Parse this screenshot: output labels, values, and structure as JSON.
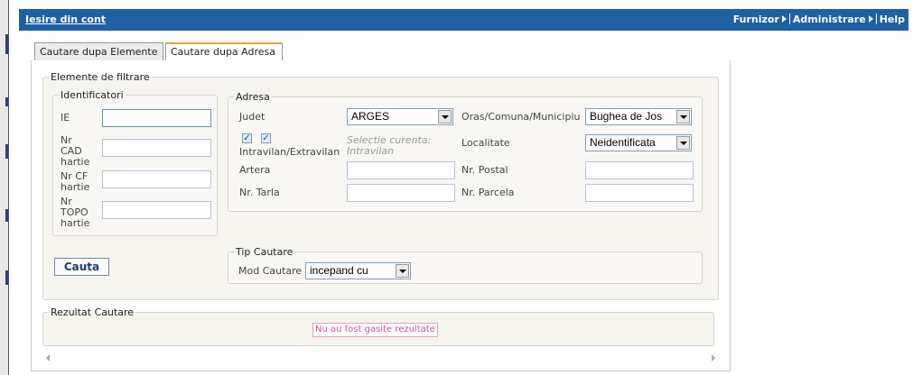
{
  "header": {
    "logout_label": "Iesire din cont",
    "nav": [
      "Furnizor",
      "Administrare",
      "Help"
    ]
  },
  "tabs": [
    {
      "label": "Cautare dupa Elemente",
      "active": false
    },
    {
      "label": "Cautare dupa Adresa",
      "active": true
    }
  ],
  "filter": {
    "legend": "Elemente de filtrare",
    "identificatori": {
      "legend": "Identificatori",
      "ie_label": "IE",
      "cad_label_l1": "Nr",
      "cad_label_l2": "CAD",
      "cad_label_l3": "hartie",
      "cf_label_l1": "Nr CF",
      "cf_label_l2": "hartie",
      "topo_label_l1": "Nr",
      "topo_label_l2": "TOPO",
      "topo_label_l3": "hartie",
      "ie_value": "",
      "cad_value": "",
      "cf_value": "",
      "topo_value": ""
    },
    "adresa": {
      "legend": "Adresa",
      "judet_label": "Judet",
      "judet_value": "ARGES",
      "oras_label": "Oras/Comuna/Municipiu",
      "oras_value": "Bughea de Jos",
      "intravilan_label": "Intravilan/Extravilan",
      "selectie_label": "Selectie curenta:",
      "selectie_value": "Intravilan",
      "localitate_label": "Localitate",
      "localitate_value": "Neidentificata",
      "artera_label": "Artera",
      "artera_value": "",
      "nr_postal_label": "Nr. Postal",
      "nr_postal_value": "",
      "nr_tarla_label": "Nr. Tarla",
      "nr_tarla_value": "",
      "nr_parcela_label": "Nr. Parcela",
      "nr_parcela_value": ""
    },
    "tip_cautare": {
      "legend": "Tip Cautare",
      "mod_label": "Mod Cautare",
      "mod_value": "incepand cu"
    },
    "search_button": "Cauta"
  },
  "results": {
    "legend": "Rezultat Cautare",
    "empty_message": "Nu au fost gasite rezultate"
  },
  "colors": {
    "topbar": "#1f5fa6",
    "active_tab_accent": "#e8a33c",
    "no_results": "#d0509a"
  }
}
